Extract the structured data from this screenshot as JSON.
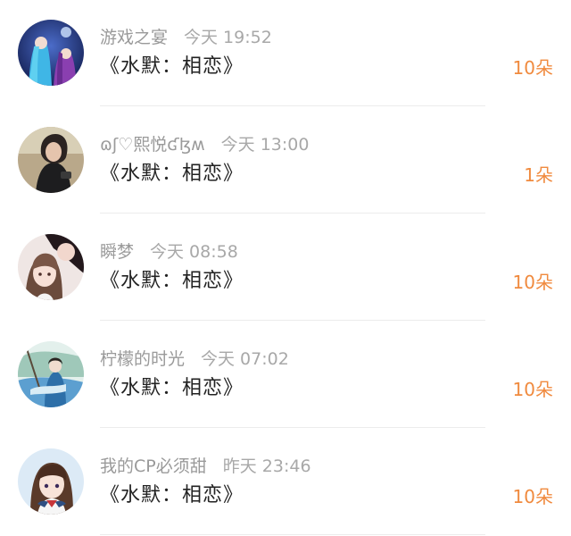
{
  "colors": {
    "count_accent": "#f08a3e",
    "name_gray": "#9a9a9a",
    "title_dark": "#222222"
  },
  "messages": [
    {
      "user": "游戏之宴",
      "time": "今天 19:52",
      "title": "《水默：相恋》",
      "count": "10朵",
      "avatar_icon": "avatar-two-anime-girls-blue"
    },
    {
      "user": "ɷʃ♡熙悦ʛɮʍ",
      "time": "今天 13:00",
      "title": "《水默：相恋》",
      "count": "1朵",
      "avatar_icon": "avatar-person-dark-hair"
    },
    {
      "user": "瞬梦",
      "time": "今天 08:58",
      "title": "《水默：相恋》",
      "count": "10朵",
      "avatar_icon": "avatar-anime-couple"
    },
    {
      "user": "柠檬的时光",
      "time": "今天 07:02",
      "title": "《水默：相恋》",
      "count": "10朵",
      "avatar_icon": "avatar-swordsman-in-blue"
    },
    {
      "user": "我的CP必须甜",
      "time": "昨天 23:46",
      "title": "《水默：相恋》",
      "count": "10朵",
      "avatar_icon": "avatar-anime-girl-school-uniform"
    }
  ]
}
